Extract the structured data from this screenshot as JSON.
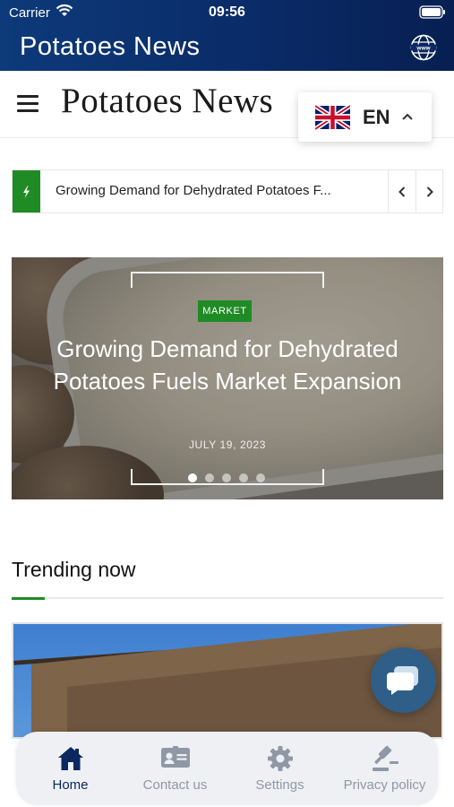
{
  "status_bar": {
    "carrier": "Carrier",
    "time": "09:56"
  },
  "app_bar": {
    "title": "Potatoes News"
  },
  "site_header": {
    "logo": "Potatoes News"
  },
  "language": {
    "code": "EN"
  },
  "ticker": {
    "text": "Growing Demand for Dehydrated Potatoes F..."
  },
  "hero": {
    "badge": "MARKET",
    "headline": "Growing Demand for Dehydrated Potatoes Fuels Market Expansion",
    "date": "JULY 19, 2023",
    "slide_count": 5,
    "active_slide": 1
  },
  "trending": {
    "title": "Trending now"
  },
  "tabs": [
    {
      "label": "Home",
      "icon": "home-icon",
      "active": true
    },
    {
      "label": "Contact us",
      "icon": "contact-card-icon",
      "active": false
    },
    {
      "label": "Settings",
      "icon": "gear-icon",
      "active": false
    },
    {
      "label": "Privacy policy",
      "icon": "gavel-icon",
      "active": false
    }
  ],
  "colors": {
    "app_bar": "#0a2a66",
    "accent_green": "#1f8b24",
    "tab_active": "#0c2860",
    "tab_inactive": "#9098a5",
    "chat_fab": "#2f5f88"
  }
}
